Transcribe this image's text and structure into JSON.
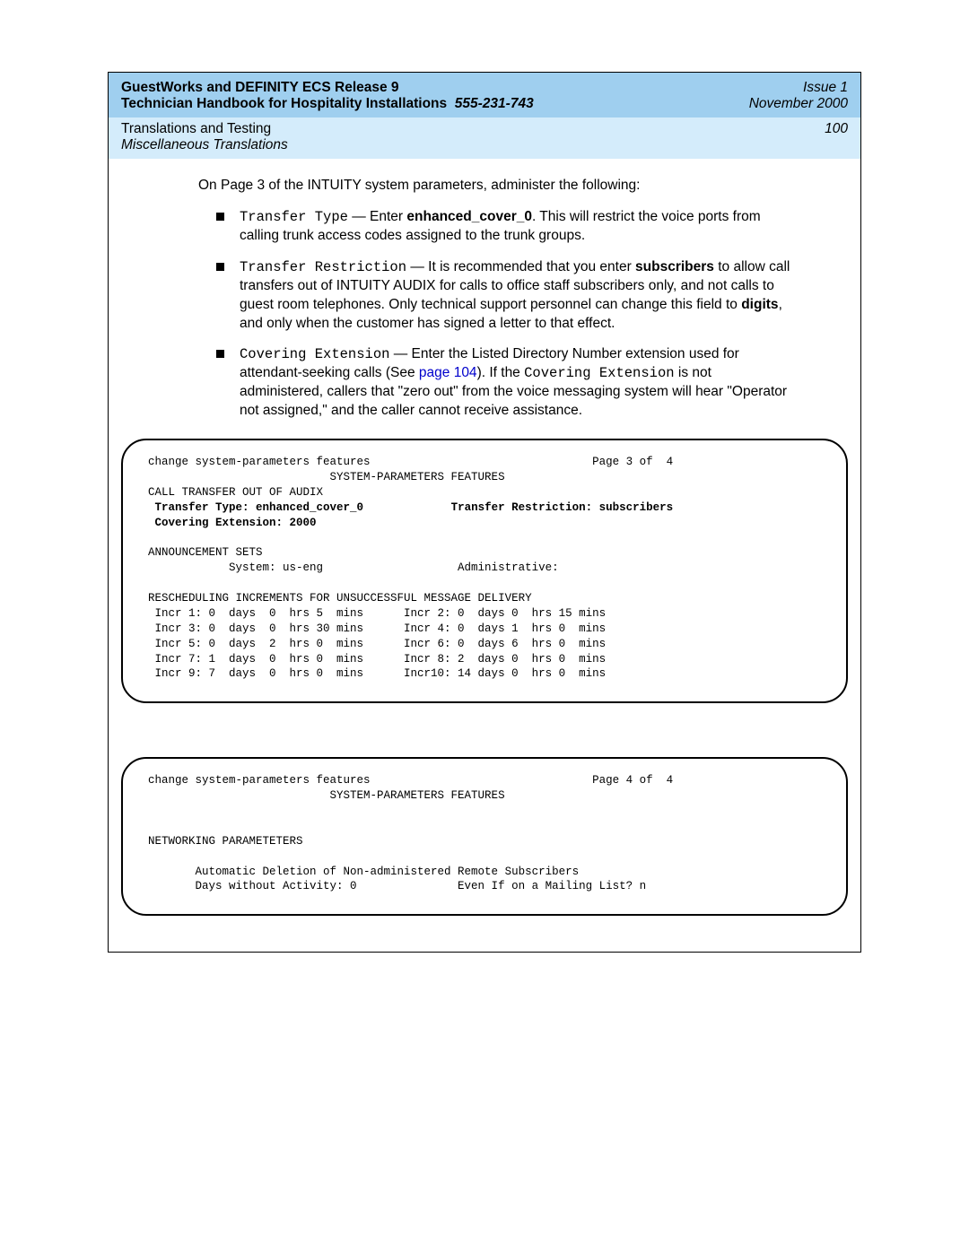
{
  "header": {
    "title": "GuestWorks and DEFINITY ECS Release 9",
    "subtitle": "Technician Handbook for Hospitality Installations",
    "docnum": "555-231-743",
    "issue": "Issue 1",
    "date": "November 2000",
    "section1": "Translations and Testing",
    "section2": "Miscellaneous Translations",
    "pagenum": "100"
  },
  "intro": "On Page 3 of the INTUITY system parameters, administer the following:",
  "bullets": {
    "b1": {
      "term": "Transfer Type",
      "sep": " — Enter ",
      "val": "enhanced_cover_0",
      "rest": ". This will restrict the voice ports from calling trunk access codes assigned to the trunk groups."
    },
    "b2": {
      "term": "Transfer Restriction",
      "sep": " — It is recommended that you enter ",
      "val": "subscribers",
      "rest1": " to allow call transfers out of INTUITY AUDIX for calls to office staff subscribers only, and not calls to guest room telephones. Only technical support personnel can change this field to ",
      "digits": "digits",
      "rest2": ", and only when the customer has signed a letter to that effect."
    },
    "b3": {
      "term": "Covering Extension",
      "sep": " — Enter the Listed Directory Number extension used for attendant-seeking calls (See ",
      "link": "page 104",
      "rest1": "). If the ",
      "term2": "Covering Extension",
      "rest2": " is not administered, callers that \"zero out\" from the voice messaging system will hear \"Operator not assigned,\" and the caller cannot receive assistance."
    }
  },
  "terminal1": {
    "line1": "change system-parameters features                                 Page 3 of  4",
    "line2": "                           SYSTEM-PARAMETERS FEATURES",
    "line3": "CALL TRANSFER OUT OF AUDIX",
    "line4a": " Transfer Type: enhanced_cover_0",
    "line4b": "             Transfer Restriction: subscribers",
    "line5": " Covering Extension: 2000",
    "blank1": "",
    "line6": "ANNOUNCEMENT SETS",
    "line7": "            System: us-eng                    Administrative:",
    "blank2": "",
    "line8": "RESCHEDULING INCREMENTS FOR UNSUCCESSFUL MESSAGE DELIVERY",
    "line9": " Incr 1: 0  days  0  hrs 5  mins      Incr 2: 0  days 0  hrs 15 mins",
    "line10": " Incr 3: 0  days  0  hrs 30 mins      Incr 4: 0  days 1  hrs 0  mins",
    "line11": " Incr 5: 0  days  2  hrs 0  mins      Incr 6: 0  days 6  hrs 0  mins",
    "line12": " Incr 7: 1  days  0  hrs 0  mins      Incr 8: 2  days 0  hrs 0  mins",
    "line13": " Incr 9: 7  days  0  hrs 0  mins      Incr10: 14 days 0  hrs 0  mins"
  },
  "terminal2": {
    "line1": "change system-parameters features                                 Page 4 of  4",
    "line2": "                           SYSTEM-PARAMETERS FEATURES",
    "blank1": "",
    "blank2": "",
    "line3": "NETWORKING PARAMETETERS",
    "blank3": "",
    "line4": "       Automatic Deletion of Non-administered Remote Subscribers",
    "line5": "       Days without Activity: 0               Even If on a Mailing List? n"
  }
}
